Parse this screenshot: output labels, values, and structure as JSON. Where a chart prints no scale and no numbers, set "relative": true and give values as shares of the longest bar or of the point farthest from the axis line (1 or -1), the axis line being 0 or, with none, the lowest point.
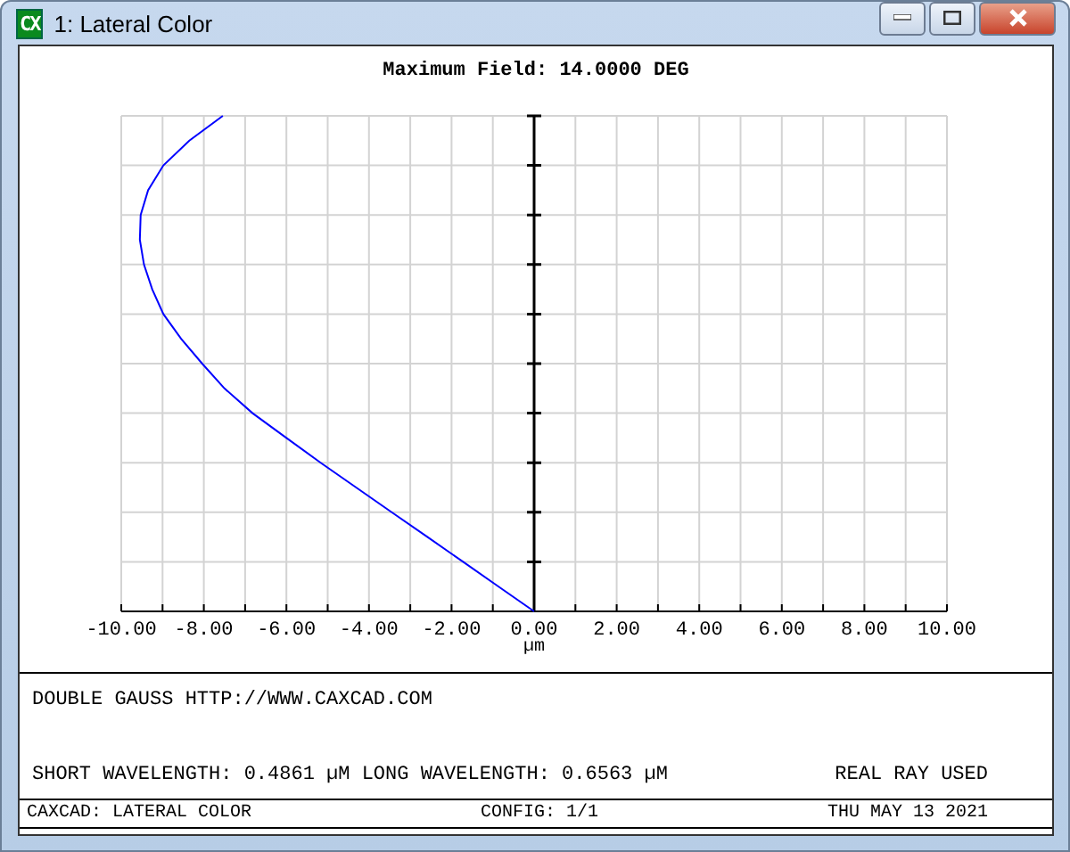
{
  "window": {
    "app_icon": "CX",
    "title": "1: Lateral Color"
  },
  "plot": {
    "title": "Maximum Field: 14.0000 DEG",
    "chart_data": {
      "type": "line",
      "relative": true,
      "grid": true,
      "xlabel": "µm",
      "xlim": [
        -10,
        10
      ],
      "ylim": [
        0,
        1
      ],
      "xticks": [
        {
          "value": -10,
          "label": "-10.00"
        },
        {
          "value": -8,
          "label": "-8.00"
        },
        {
          "value": -6,
          "label": "-6.00"
        },
        {
          "value": -4,
          "label": "-4.00"
        },
        {
          "value": -2,
          "label": "-2.00"
        },
        {
          "value": 0,
          "label": "0.00"
        },
        {
          "value": 2,
          "label": "2.00"
        },
        {
          "value": 4,
          "label": "4.00"
        },
        {
          "value": 6,
          "label": "6.00"
        },
        {
          "value": 8,
          "label": "8.00"
        },
        {
          "value": 10,
          "label": "10.00"
        }
      ],
      "x": [
        0,
        -0.86,
        -1.72,
        -2.58,
        -3.45,
        -4.31,
        -5.17,
        -6.0,
        -6.82,
        -7.5,
        -8.04,
        -8.55,
        -8.98,
        -9.25,
        -9.45,
        -9.55,
        -9.53,
        -9.35,
        -8.98,
        -8.35,
        -7.54
      ],
      "series": [
        {
          "color": "#0000ff",
          "values": [
            0,
            0.05,
            0.1,
            0.15,
            0.2,
            0.25,
            0.3,
            0.35,
            0.4,
            0.45,
            0.5,
            0.55,
            0.6,
            0.65,
            0.7,
            0.75,
            0.8,
            0.85,
            0.9,
            0.95,
            1.0
          ]
        }
      ]
    }
  },
  "info": {
    "lens": "DOUBLE GAUSS  HTTP://WWW.CAXCAD.COM",
    "wavelengths": "SHORT WAVELENGTH: 0.4861 µM LONG WAVELENGTH: 0.6563 µM",
    "ray_note": "REAL RAY USED"
  },
  "status_bar": {
    "left": "CAXCAD: LATERAL COLOR",
    "center": "CONFIG: 1/1",
    "right": "THU MAY 13 2021"
  }
}
